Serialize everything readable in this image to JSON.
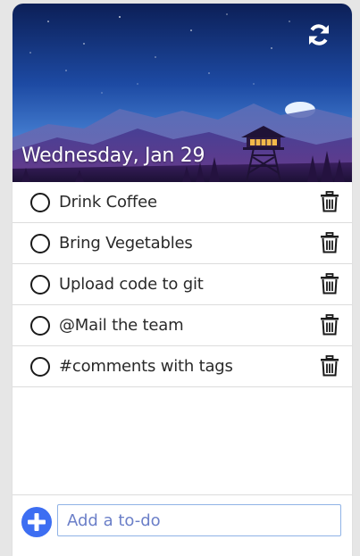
{
  "header": {
    "date": "Wednesday, Jan 29",
    "refresh_icon": "refresh-icon"
  },
  "todos": [
    {
      "label": "Drink Coffee",
      "done": false
    },
    {
      "label": "Bring Vegetables",
      "done": false
    },
    {
      "label": "Upload code to git",
      "done": false
    },
    {
      "label": "@Mail the team",
      "done": false
    },
    {
      "label": "#comments with tags",
      "done": false
    }
  ],
  "footer": {
    "add_icon": "plus-circle-icon",
    "input_placeholder": "Add a to-do",
    "input_value": ""
  },
  "colors": {
    "accent": "#3d6ef2",
    "sky_top": "#0f2a6b",
    "sky_bottom": "#3a6fc7"
  }
}
